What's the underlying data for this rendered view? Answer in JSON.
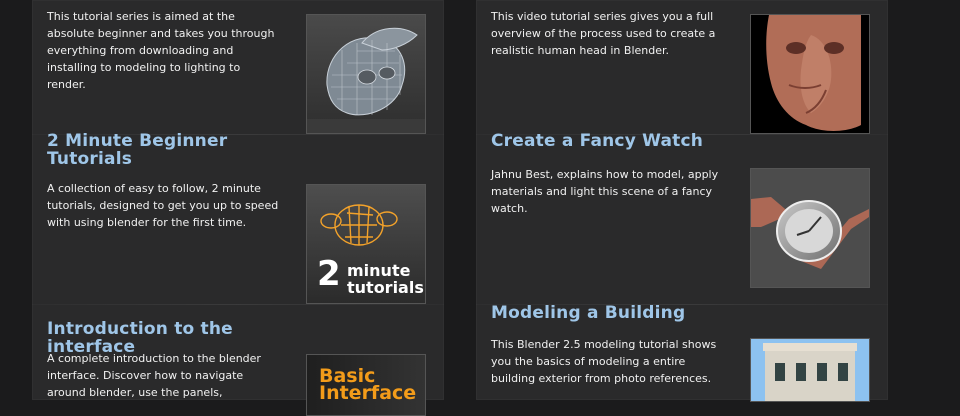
{
  "left_column": {
    "items": [
      {
        "title": "",
        "description": "This tutorial series is aimed at the absolute beginner and takes you through everything from downloading and installing to modeling to lighting to render.",
        "thumbnail": "monkey-wireframe-icon"
      },
      {
        "title": "2 Minute Beginner Tutorials",
        "description": "A collection of easy to follow, 2 minute tutorials, designed to get you up to speed with using blender for the first time.",
        "thumbnail": "2-minute-tutorials-icon",
        "thumb_big": "2",
        "thumb_word1": "minute",
        "thumb_word2": "tutorials"
      },
      {
        "title": "Introduction to the interface",
        "description": "A complete introduction to the blender interface. Discover how to navigate around blender, use the panels,",
        "thumbnail": "basic-interface-icon",
        "thumb_text1": "Basic",
        "thumb_text2": "Interface"
      }
    ]
  },
  "right_column": {
    "items": [
      {
        "title": "",
        "description": "This video tutorial series gives you a full overview of the process used to create a realistic human head in Blender.",
        "thumbnail": "human-head-icon"
      },
      {
        "title": "Create a Fancy Watch",
        "description": "Jahnu Best, explains how to model, apply materials and light this scene of a fancy watch.",
        "thumbnail": "watch-icon"
      },
      {
        "title": "Modeling a Building",
        "description": "This Blender 2.5 modeling tutorial shows you the basics of modeling a entire building exterior from photo references.",
        "thumbnail": "building-icon"
      }
    ]
  },
  "colors": {
    "background": "#1b1b1c",
    "panel": "#2a2a2b",
    "title": "#9fc6e8",
    "text": "#f1f1f1",
    "accent_orange": "#f39c1a"
  }
}
